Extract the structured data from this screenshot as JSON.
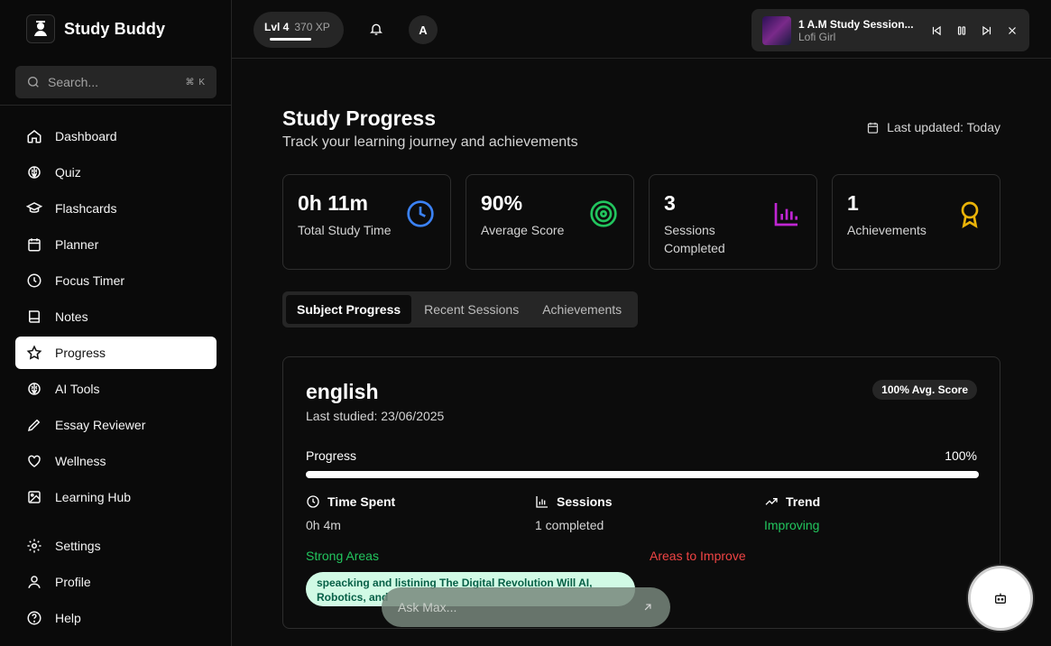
{
  "brand": {
    "name": "Study Buddy",
    "logo_caption": "STUDY BUDDY"
  },
  "search": {
    "placeholder": "Search...",
    "shortcut": "⌘ K"
  },
  "nav": {
    "items": [
      {
        "label": "Dashboard",
        "icon": "home-icon"
      },
      {
        "label": "Quiz",
        "icon": "brain-icon"
      },
      {
        "label": "Flashcards",
        "icon": "graduation-cap-icon"
      },
      {
        "label": "Planner",
        "icon": "calendar-icon"
      },
      {
        "label": "Focus Timer",
        "icon": "clock-icon"
      },
      {
        "label": "Notes",
        "icon": "book-icon"
      },
      {
        "label": "Progress",
        "icon": "star-icon",
        "active": true
      },
      {
        "label": "AI Tools",
        "icon": "brain-icon"
      },
      {
        "label": "Essay Reviewer",
        "icon": "pencil-icon"
      },
      {
        "label": "Wellness",
        "icon": "heart-icon"
      },
      {
        "label": "Learning Hub",
        "icon": "image-icon"
      }
    ],
    "bottom": [
      {
        "label": "Settings",
        "icon": "gear-icon"
      },
      {
        "label": "Profile",
        "icon": "user-icon"
      },
      {
        "label": "Help",
        "icon": "help-circle-icon"
      }
    ]
  },
  "topbar": {
    "level": "Lvl 4",
    "xp": "370 XP",
    "xp_progress": 0.7,
    "avatar_initial": "A"
  },
  "player": {
    "title": "1 A.M Study Session...",
    "artist": "Lofi Girl"
  },
  "page": {
    "title": "Study Progress",
    "subtitle": "Track your learning journey and achievements",
    "last_updated": "Last updated: Today"
  },
  "stats": [
    {
      "value": "0h 11m",
      "label": "Total Study Time",
      "icon": "clock-icon",
      "color": "#3b82f6"
    },
    {
      "value": "90%",
      "label": "Average Score",
      "icon": "target-icon",
      "color": "#22c55e"
    },
    {
      "value": "3",
      "label": "Sessions Completed",
      "icon": "bar-chart-icon",
      "color": "#c026d3"
    },
    {
      "value": "1",
      "label": "Achievements",
      "icon": "award-icon",
      "color": "#eab308"
    }
  ],
  "tabs": [
    {
      "label": "Subject Progress",
      "active": true
    },
    {
      "label": "Recent Sessions"
    },
    {
      "label": "Achievements"
    }
  ],
  "subject": {
    "name": "english",
    "last_studied": "Last studied: 23/06/2025",
    "avg_badge": "100% Avg. Score",
    "progress_label": "Progress",
    "progress_value": "100%",
    "progress": 1.0,
    "time_spent_label": "Time Spent",
    "time_spent": "0h 4m",
    "sessions_label": "Sessions",
    "sessions": "1 completed",
    "trend_label": "Trend",
    "trend": "Improving",
    "strong_label": "Strong Areas",
    "improve_label": "Areas to Improve",
    "strong_chip": "speacking and listining The Digital Revolution Will AI, Robotics, and"
  },
  "assistant": {
    "placeholder": "Ask Max..."
  }
}
